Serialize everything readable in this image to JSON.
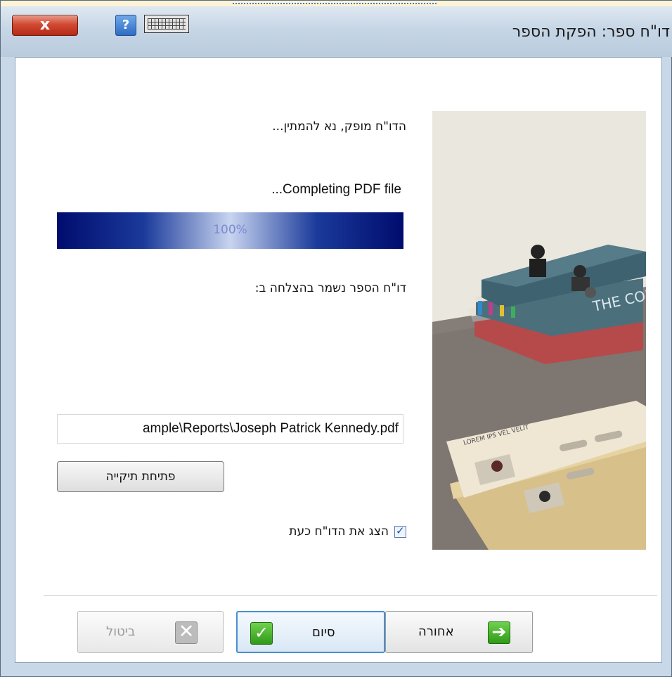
{
  "window": {
    "title": "דו\"ח ספר: הפקת הספר",
    "close_symbol": "x",
    "help_symbol": "?"
  },
  "report": {
    "status_text": "הדו\"ח מופק, נא להמתין...",
    "progress_text": "...Completing PDF file",
    "progress_label": "100%",
    "progress_fraction": 1.0,
    "saved_text": "דו\"ח הספר נשמר בהצלחה ב:",
    "file_path": "ample\\Reports\\Joseph Patrick Kennedy.pdf",
    "open_folder_label": "פתיחת תיקייה",
    "show_report_label": "הצג את הדו\"ח כעת",
    "show_report_checked": true
  },
  "illustration": {
    "book_title": "THE COPP",
    "paper_heading": "LOREM IPS VEL VELIT"
  },
  "buttons": {
    "cancel_label": "ביטול",
    "finish_label": "סיום",
    "back_label": "אחורה"
  },
  "colors": {
    "progress_dark": "#000c6e",
    "progress_light": "#c8d4f0",
    "close_red": "#d24a33",
    "check_green": "#2f9a18",
    "finish_border": "#4a8fd0"
  }
}
